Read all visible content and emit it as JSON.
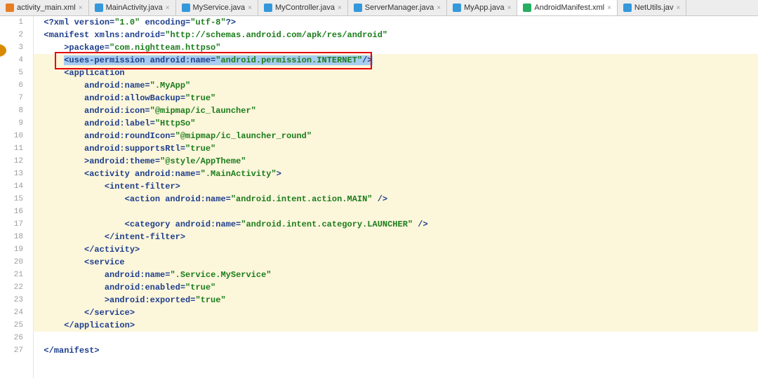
{
  "tabs": [
    {
      "label": "activity_main.xml",
      "icon": "xml",
      "active": false
    },
    {
      "label": "MainActivity.java",
      "icon": "java",
      "active": false
    },
    {
      "label": "MyService.java",
      "icon": "java",
      "active": false
    },
    {
      "label": "MyController.java",
      "icon": "java",
      "active": false
    },
    {
      "label": "ServerManager.java",
      "icon": "java",
      "active": false
    },
    {
      "label": "MyApp.java",
      "icon": "java",
      "active": false
    },
    {
      "label": "AndroidManifest.xml",
      "icon": "manifest",
      "active": true
    },
    {
      "label": "NetUtils.jav",
      "icon": "java",
      "active": false
    }
  ],
  "line_numbers": [
    "1",
    "2",
    "3",
    "4",
    "5",
    "6",
    "7",
    "8",
    "9",
    "10",
    "11",
    "12",
    "13",
    "14",
    "15",
    "16",
    "17",
    "18",
    "19",
    "20",
    "21",
    "22",
    "23",
    "24",
    "25",
    "26",
    "27"
  ],
  "code": {
    "l1": {
      "pre": "  ",
      "t1": "<?xml",
      "a1": " version=",
      "v1": "\"1.0\"",
      "a2": " encoding=",
      "v2": "\"utf-8\"",
      "t2": "?>"
    },
    "l2": {
      "pre": "  ",
      "t": "<manifest ",
      "a": "xmlns:android=",
      "v": "\"http://schemas.android.com/apk/res/android\""
    },
    "l3": {
      "pre": "      ",
      "a": "package=",
      "v": "\"com.nightteam.httpso\"",
      "t": ">"
    },
    "l4": {
      "pre": "      ",
      "t1": "<uses-permission ",
      "a": "android:name=",
      "v": "\"android.permission.INTERNET\"",
      "t2": "/>"
    },
    "l5": {
      "pre": "      ",
      "t": "<application"
    },
    "l6": {
      "pre": "          ",
      "a": "android:name=",
      "v": "\".MyApp\""
    },
    "l7": {
      "pre": "          ",
      "a": "android:allowBackup=",
      "v": "\"true\""
    },
    "l8": {
      "pre": "          ",
      "a": "android:icon=",
      "v": "\"@mipmap/ic_launcher\""
    },
    "l9": {
      "pre": "          ",
      "a": "android:label=",
      "v": "\"HttpSo\""
    },
    "l10": {
      "pre": "          ",
      "a": "android:roundIcon=",
      "v": "\"@mipmap/ic_launcher_round\""
    },
    "l11": {
      "pre": "          ",
      "a": "android:supportsRtl=",
      "v": "\"true\""
    },
    "l12": {
      "pre": "          ",
      "a": "android:theme=",
      "v": "\"@style/AppTheme\"",
      "t": ">"
    },
    "l13": {
      "pre": "          ",
      "t1": "<activity ",
      "a": "android:name=",
      "v": "\".MainActivity\"",
      "t2": ">"
    },
    "l14": {
      "pre": "              ",
      "t": "<intent-filter>"
    },
    "l15": {
      "pre": "                  ",
      "t1": "<action ",
      "a": "android:name=",
      "v": "\"android.intent.action.MAIN\"",
      "t2": " />"
    },
    "l16": {
      "pre": ""
    },
    "l17": {
      "pre": "                  ",
      "t1": "<category ",
      "a": "android:name=",
      "v": "\"android.intent.category.LAUNCHER\"",
      "t2": " />"
    },
    "l18": {
      "pre": "              ",
      "t": "</intent-filter>"
    },
    "l19": {
      "pre": "          ",
      "t": "</activity>"
    },
    "l20": {
      "pre": "          ",
      "t": "<service"
    },
    "l21": {
      "pre": "              ",
      "a": "android:name=",
      "v": "\".Service.MyService\""
    },
    "l22": {
      "pre": "              ",
      "a": "android:enabled=",
      "v": "\"true\""
    },
    "l23": {
      "pre": "              ",
      "a": "android:exported=",
      "v": "\"true\"",
      "t": ">"
    },
    "l24": {
      "pre": "          ",
      "t": "</service>"
    },
    "l25": {
      "pre": "      ",
      "t": "</application>"
    },
    "l26": {
      "pre": ""
    },
    "l27": {
      "pre": "  ",
      "t": "</manifest>"
    }
  }
}
